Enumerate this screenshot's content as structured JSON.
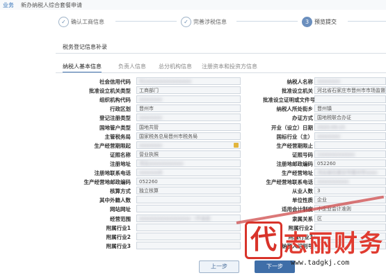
{
  "topbar": {
    "left": "业务",
    "title": "新办纳税人综合套餐申请"
  },
  "steps": [
    {
      "num": "1",
      "label": "确认工商信息"
    },
    {
      "num": "2",
      "label": "完善涉税信息"
    },
    {
      "num": "3",
      "label": "预览提交"
    }
  ],
  "section_title": "税务登记信息补录",
  "tabs": [
    "纳税人基本信息",
    "负责人信息",
    "总分机构信息",
    "注册资本和投资方信息"
  ],
  "left_rows": [
    {
      "label": "社会信用代码",
      "value": "91xxxxxxxxxxxxxxxx",
      "blur": true
    },
    {
      "label": "批准设立机关类型",
      "value": "工商部门"
    },
    {
      "label": "组织机构代码",
      "value": "xxxxxxxx",
      "blur": true
    },
    {
      "label": "行政区划",
      "value": "晋州市"
    },
    {
      "label": "登记注册类型",
      "value": "xxxxxxxx",
      "blur": true
    },
    {
      "label": "国地管户类型",
      "value": "国地共管"
    },
    {
      "label": "主管税务局",
      "value": "国家税务总局晋州市税务局"
    },
    {
      "label": "生产经营期限起",
      "value": "xxxxxxxx",
      "blur": true,
      "calendar": true
    },
    {
      "label": "证照名称",
      "value": "营业执照"
    },
    {
      "label": "注册地址",
      "value": "河北xxxxxxxxxxxx",
      "blur": true
    },
    {
      "label": "注册地联系电话",
      "value": "xxxxxxx6",
      "blur": true
    },
    {
      "label": "生产经营地邮政编码",
      "value": "052260"
    },
    {
      "label": "核算方式",
      "value": "独立核算"
    },
    {
      "label": "其中外籍人数",
      "value": ""
    },
    {
      "label": "网站网址",
      "value": ""
    },
    {
      "label": "经营范围",
      "value": "xxxxxxxxxxxxxxxxxx（不含前",
      "blur": true
    },
    {
      "label": "附属行业1",
      "value": ""
    },
    {
      "label": "附属行业2",
      "value": ""
    },
    {
      "label": "附属行业3",
      "value": ""
    }
  ],
  "right_rows": [
    {
      "label": "纳税人名称",
      "value": "xxxxxxxx",
      "blur": true
    },
    {
      "label": "批准设立机关",
      "value": "河北省石家庄市晋州市市场监督管"
    },
    {
      "label": "批准设立证明或文件号",
      "value": ""
    },
    {
      "label": "纳税人所处街乡",
      "value": "晋州镇"
    },
    {
      "label": "办证方式",
      "value": "国地税联合办证"
    },
    {
      "label": "开业（设立）日期",
      "value": "2020.09.15",
      "blur": true
    },
    {
      "label": "国标行业（主）",
      "value": "xxxxxxxx",
      "blur": true
    },
    {
      "label": "生产经营期限止",
      "value": ""
    },
    {
      "label": "证照号码",
      "value": "1xxxxxxxxxxxx",
      "blur": true
    },
    {
      "label": "注册地邮政编码",
      "value": "052260"
    },
    {
      "label": "生产经营地址",
      "value": "河北省石家庄市晋州市xxxx",
      "blur": true
    },
    {
      "label": "生产经营地联系电话",
      "value": "xxxxxxxxxxx",
      "blur": true
    },
    {
      "label": "从业人数",
      "value": "3"
    },
    {
      "label": "单位性质",
      "value": "企业"
    },
    {
      "label": "适用会计制度",
      "value": "小企业会计准则"
    },
    {
      "label": "隶属关系",
      "value": "区"
    },
    {
      "label": "附属行业2",
      "value": ""
    },
    {
      "label": "附属行业3",
      "value": ""
    },
    {
      "label": "纳税人识别号",
      "value": ""
    }
  ],
  "buttons": {
    "prev": "上一步",
    "next": "下一步"
  },
  "watermark": {
    "badge": "代",
    "name": "志丽财务",
    "url": "www.tadgkj.com"
  }
}
